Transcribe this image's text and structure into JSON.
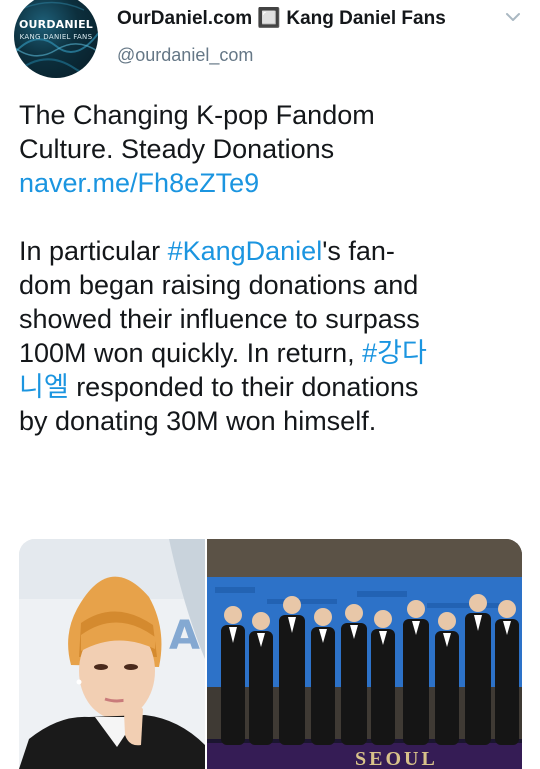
{
  "tweet": {
    "author": {
      "display_name": "OurDaniel.com 🔲 Kang Daniel Fans",
      "handle": "@ourdaniel_com",
      "avatar_line1": "OURDANIEL",
      "avatar_line2": "KANG DANIEL FANS"
    },
    "text": {
      "headline_line1": "The Changing K-pop Fandom",
      "headline_line2": "Culture. Steady Donations",
      "link": "naver.me/Fh8eZTe9",
      "p2_line1_a": "In particular ",
      "p2_line1_hashtag": "#KangDaniel",
      "p2_line1_b": "'s fan-",
      "p2_line2": "dom began raising donations and",
      "p2_line3": "showed their influence to surpass",
      "p2_line4_a": "100M won quickly. In return, ",
      "p2_line4_hashtag": "#강다",
      "p2_line5_hashtag": "니엘",
      "p2_line5_b": " responded to their donations",
      "p2_line6": "by donating 30M won himself."
    },
    "media": {
      "right_banner_text": "SEOUL"
    }
  },
  "colors": {
    "link": "#1b95e0",
    "text": "#14171a",
    "secondary": "#657786"
  }
}
